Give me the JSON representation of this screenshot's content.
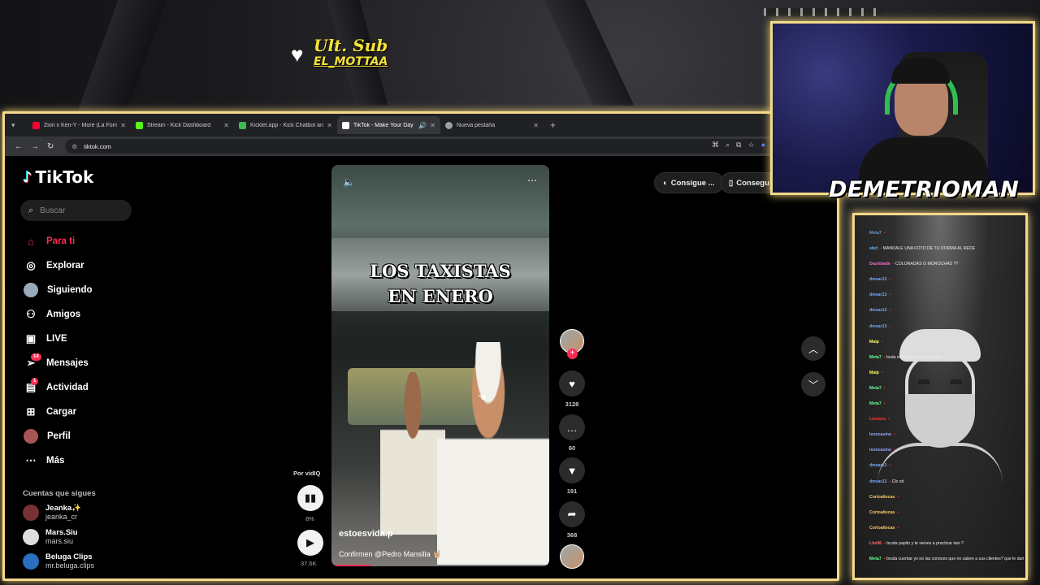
{
  "overlay": {
    "sub_title": "Ult. Sub",
    "sub_name": "EL_MOTTAA",
    "streamer_name": "DEMETRIOMAN"
  },
  "browser": {
    "tabs": [
      {
        "title": "Zion x Ken-Y - More (La Formu",
        "favicon_color": "#ff0033",
        "active": false
      },
      {
        "title": "Stream - Kick Dashboard",
        "favicon_color": "#53fc18",
        "active": false
      },
      {
        "title": "Kicklet.app - Kick Chatbot and",
        "favicon_color": "#3fb950",
        "active": false
      },
      {
        "title": "TikTok - Make Your Day",
        "favicon_color": "#ffffff",
        "active": true
      },
      {
        "title": "Nueva pestaña",
        "favicon_color": "#9aa0a6",
        "active": false
      }
    ],
    "url": "tiktok.com"
  },
  "tiktok": {
    "logo": "TikTok",
    "search_placeholder": "Buscar",
    "nav": [
      {
        "label": "Para ti",
        "icon": "home-icon",
        "active": true,
        "badge": ""
      },
      {
        "label": "Explorar",
        "icon": "compass-icon",
        "active": false,
        "badge": ""
      },
      {
        "label": "Siguiendo",
        "icon": "following-avatar-icon",
        "active": false,
        "badge": ""
      },
      {
        "label": "Amigos",
        "icon": "friends-icon",
        "active": false,
        "badge": ""
      },
      {
        "label": "LIVE",
        "icon": "live-tv-icon",
        "active": false,
        "badge": ""
      },
      {
        "label": "Mensajes",
        "icon": "messages-icon",
        "active": false,
        "badge": "14"
      },
      {
        "label": "Actividad",
        "icon": "activity-icon",
        "active": false,
        "badge": "1"
      },
      {
        "label": "Cargar",
        "icon": "upload-icon",
        "active": false,
        "badge": ""
      },
      {
        "label": "Perfil",
        "icon": "profile-icon",
        "active": false,
        "badge": ""
      },
      {
        "label": "Más",
        "icon": "more-icon",
        "active": false,
        "badge": ""
      }
    ],
    "following_header": "Cuentas que sigues",
    "accounts": [
      {
        "name": "Jeanka✨",
        "handle": "jeanka_cr"
      },
      {
        "name": "Mars.Siu",
        "handle": "mars.siu"
      },
      {
        "name": "Beluga Clips",
        "handle": "mr.beluga.clips"
      }
    ],
    "vidiq": {
      "label": "Por vidIQ",
      "percent": "8%",
      "views": "37.6K"
    },
    "video": {
      "overlay_line1": "LOS TAXISTAS",
      "overlay_line2": "EN ENERO",
      "author": "estoesvida.p",
      "description": "Confirmen @Pedro Mansilla 🤘🏼",
      "progress": 0.18
    },
    "actions": {
      "likes": "3128",
      "comments": "60",
      "saves": "191",
      "shares": "368"
    },
    "top_buttons": [
      "Consigue ...",
      "Consegui"
    ]
  },
  "chat": {
    "messages": [
      {
        "user": "Meta7",
        "text": "",
        "color": "#69c"
      },
      {
        "user": "sbcl",
        "text": "MANDALE UNA FOTO DE TU DORMA AL REDE",
        "color": "#6bf"
      },
      {
        "user": "Dazeblade",
        "text": "COLORADAS O MOROCHAS ??",
        "color": "#f6c"
      },
      {
        "user": "dmsar13",
        "text": "",
        "color": "#7af"
      },
      {
        "user": "dmsar13",
        "text": "",
        "color": "#7af"
      },
      {
        "user": "dmsar13",
        "text": "",
        "color": "#7af"
      },
      {
        "user": "dmsar13",
        "text": "",
        "color": "#7af"
      },
      {
        "user": "Maip",
        "text": "",
        "color": "#ff6"
      },
      {
        "user": "Meta7",
        "text": "buda ese sabes es un mucho",
        "color": "#6f9"
      },
      {
        "user": "Maip",
        "text": "",
        "color": "#ff6"
      },
      {
        "user": "Meta7",
        "text": "",
        "color": "#6f9"
      },
      {
        "user": "Meta7",
        "text": "",
        "color": "#6f9"
      },
      {
        "user": "Lwotera",
        "text": "",
        "color": "#f33"
      },
      {
        "user": "lsoncasino",
        "text": "",
        "color": "#9af"
      },
      {
        "user": "lsoncasino",
        "text": "",
        "color": "#9af"
      },
      {
        "user": "dmsar13",
        "text": "",
        "color": "#7af"
      },
      {
        "user": "dmsar13",
        "text": "Clo xd",
        "color": "#7af"
      },
      {
        "user": "Cortoaltecas",
        "text": "",
        "color": "#fc6"
      },
      {
        "user": "Cortoaltecas",
        "text": "",
        "color": "#fc6"
      },
      {
        "user": "Cortoaltecas",
        "text": "",
        "color": "#fc6"
      },
      {
        "user": "Lite96",
        "text": "bruda papito y te vienes a practicar taxi ?",
        "color": "#f66"
      },
      {
        "user": "Meta7",
        "text": "bruda cuentar yo no las conoces que no saben a sus clientes? que le daria saber a su mejor maes?",
        "color": "#6f9"
      }
    ]
  }
}
